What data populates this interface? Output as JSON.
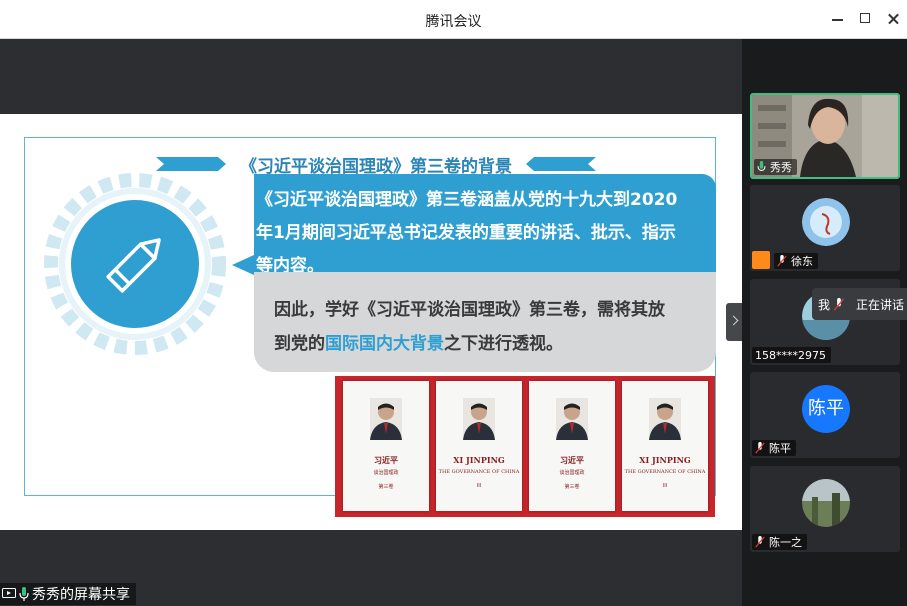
{
  "window": {
    "title": "腾讯会议"
  },
  "slide": {
    "title": "《习近平谈治国理政》第三卷的背景",
    "blue_lines": [
      "《习近平谈治国理政》第三卷涵盖从党的十九大到2020",
      "年1月期间习近平总书记发表的重要的讲话、批示、指示",
      "等内容。"
    ],
    "gray_line1": "因此，学好《习近平谈治国理政》第三卷，需将其放",
    "gray_line2_a": "到党的",
    "gray_line2_hl": "国际国内大背景",
    "gray_line2_b": "之下进行透视。",
    "books": [
      {
        "title": "习近平",
        "sub": "谈治国理政",
        "vol": "第三卷"
      },
      {
        "title": "XI JINPING",
        "sub": "THE GOVERNANCE OF CHINA",
        "vol": "III"
      },
      {
        "title": "习近平",
        "sub": "谈治国理政",
        "vol": "第三卷"
      },
      {
        "title": "XI JINPING",
        "sub": "THE GOVERNANCE OF CHINA",
        "vol": "III"
      }
    ]
  },
  "share": {
    "label": "秀秀的屏幕共享"
  },
  "participants": [
    {
      "name": "秀秀",
      "type": "video"
    },
    {
      "name": "徐东",
      "type": "avatar-image"
    },
    {
      "name": "158****2975",
      "type": "avatar-image"
    },
    {
      "name": "陈平",
      "type": "avatar-text",
      "avatar_text": "陈平"
    },
    {
      "name": "陈一之",
      "type": "avatar-image"
    }
  ],
  "speaking": {
    "me_label": "我",
    "status": "正在讲话"
  },
  "colors": {
    "accent_blue": "#2f9fd2",
    "speaking_green": "#3fbf7f",
    "avatar_blue": "#1677ff"
  }
}
